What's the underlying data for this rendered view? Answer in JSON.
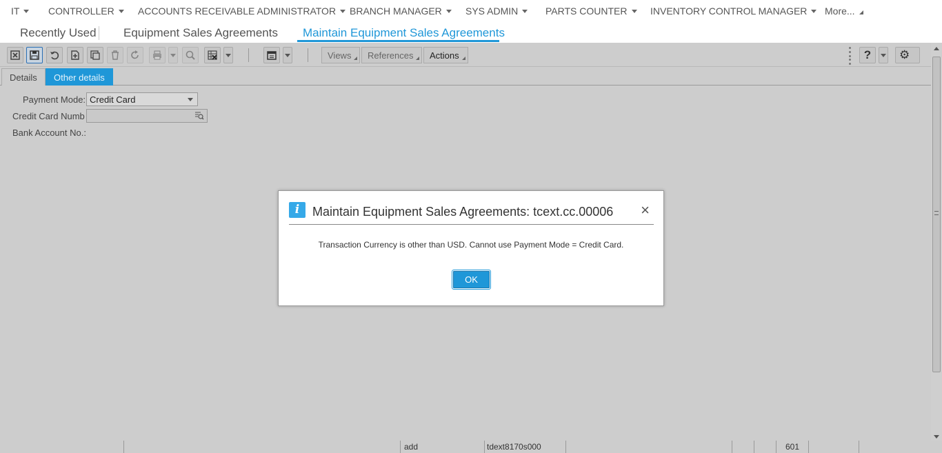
{
  "roles": [
    {
      "label": "IT",
      "dropdown": true
    },
    {
      "label": "CONTROLLER",
      "dropdown": true
    },
    {
      "label": "ACCOUNTS RECEIVABLE ADMINISTRATOR",
      "dropdown": true
    },
    {
      "label": "BRANCH MANAGER",
      "dropdown": true
    },
    {
      "label": "SYS ADMIN",
      "dropdown": true
    },
    {
      "label": "PARTS COUNTER",
      "dropdown": true
    },
    {
      "label": "INVENTORY CONTROL MANAGER",
      "dropdown": true
    },
    {
      "label": "More...",
      "dropdown": false
    }
  ],
  "breadcrumbs": [
    {
      "label": "Recently Used",
      "active": false
    },
    {
      "label": "Equipment Sales Agreements",
      "active": false
    },
    {
      "label": "Maintain Equipment Sales Agreements",
      "active": true
    }
  ],
  "toolbar": {
    "icons": [
      "cancel-icon",
      "save-icon",
      "undo-icon",
      "new-record-icon",
      "duplicate-icon",
      "delete-icon",
      "refresh-icon",
      "print-icon",
      "find-icon",
      "export-excel-icon",
      "calendar-icon",
      "help-icon",
      "settings-icon"
    ],
    "views_label": "Views",
    "references_label": "References",
    "actions_label": "Actions",
    "help_glyph": "?",
    "settings_glyph": "⚙"
  },
  "subtabs": [
    {
      "label": "Details",
      "active": false
    },
    {
      "label": "Other details",
      "active": true
    }
  ],
  "form": {
    "payment_mode_label": "Payment Mode:",
    "payment_mode_value": "Credit Card",
    "credit_card_label": "Credit Card Numb",
    "credit_card_value": "",
    "bank_account_label": "Bank Account No.:"
  },
  "statusbar": {
    "mode": "add",
    "session": "tdext8170s000",
    "code": "601"
  },
  "dialog": {
    "icon": "info-icon",
    "icon_glyph": "i",
    "title": "Maintain Equipment Sales Agreements: tcext.cc.00006",
    "message": "Transaction Currency is other than USD. Cannot use Payment Mode = Credit Card.",
    "ok_label": "OK",
    "close_glyph": "×"
  },
  "colors": {
    "accent": "#1f97d8",
    "overlay_grey": "#cdcdcd",
    "dialog_bg": "#ffffff"
  }
}
